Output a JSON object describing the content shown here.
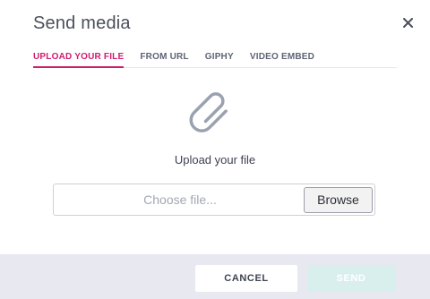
{
  "dialog": {
    "title": "Send media",
    "close_icon": "close-icon"
  },
  "tabs": [
    {
      "label": "UPLOAD YOUR FILE",
      "active": true
    },
    {
      "label": "FROM URL",
      "active": false
    },
    {
      "label": "GIPHY",
      "active": false
    },
    {
      "label": "VIDEO EMBED",
      "active": false
    }
  ],
  "upload": {
    "icon": "paperclip-icon",
    "label": "Upload your file",
    "file_placeholder": "Choose file...",
    "browse_label": "Browse"
  },
  "footer": {
    "cancel_label": "CANCEL",
    "send_label": "SEND",
    "send_enabled": false
  },
  "colors": {
    "accent": "#d01c70",
    "footer_bg": "#e7e8f0",
    "send_disabled_bg": "#d9efee",
    "icon_gray": "#9aa1b0"
  }
}
